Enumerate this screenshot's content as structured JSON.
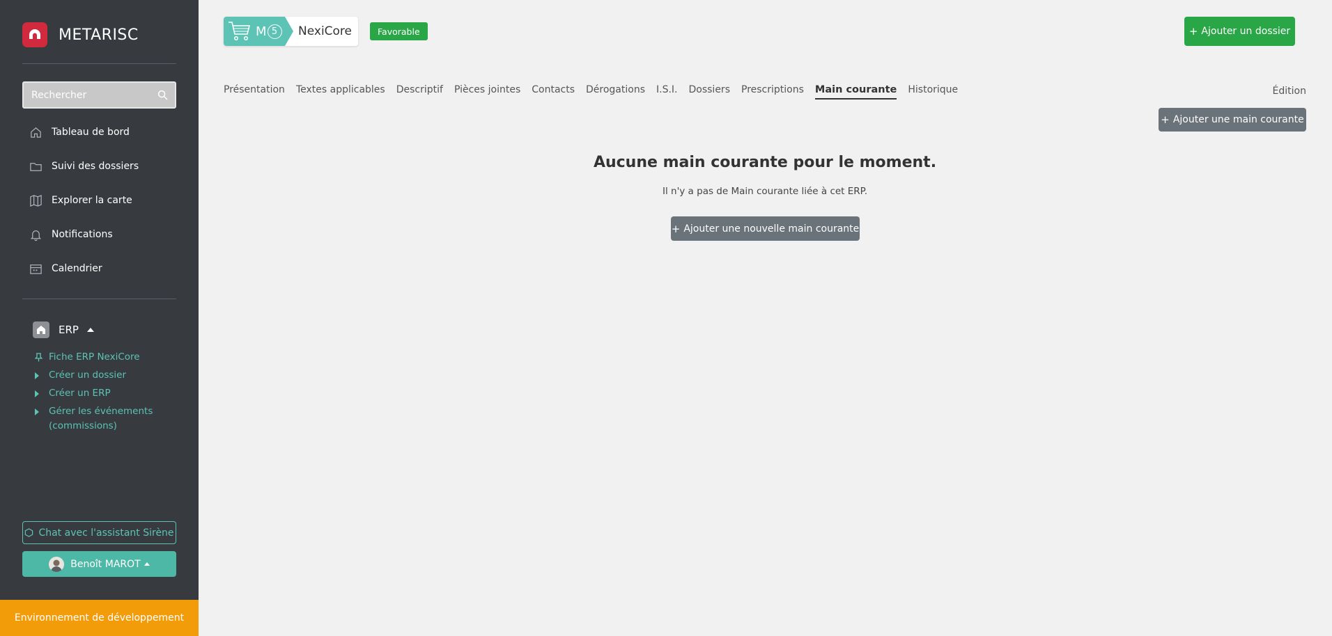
{
  "app": {
    "name": "METARISC",
    "brand_color": "#d1293d"
  },
  "sidebar": {
    "search_placeholder": "Rechercher",
    "nav": [
      {
        "label": "Tableau de bord",
        "icon": "home-icon"
      },
      {
        "label": "Suivi des dossiers",
        "icon": "folder-icon"
      },
      {
        "label": "Explorer la carte",
        "icon": "map-icon"
      },
      {
        "label": "Notifications",
        "icon": "bell-icon"
      },
      {
        "label": "Calendrier",
        "icon": "calendar-icon"
      }
    ],
    "erp_section": {
      "label": "ERP",
      "items": [
        {
          "label": "Fiche ERP NexiCore",
          "icon": "pin-icon"
        },
        {
          "label": "Créer un dossier",
          "icon": "caret-right-icon"
        },
        {
          "label": "Créer un ERP",
          "icon": "caret-right-icon"
        },
        {
          "label": "Gérer les événements (commissions)",
          "icon": "caret-right-icon"
        }
      ]
    },
    "chat_label": "Chat avec l'assistant Sirène",
    "user_name": "Benoît MAROT",
    "environment": "Environnement de développement"
  },
  "header": {
    "erp_type": "M",
    "erp_category": "5",
    "erp_name": "NexiCore",
    "avis": "Favorable",
    "add_dossier": "Ajouter un dossier"
  },
  "tabs": [
    {
      "label": "Présentation",
      "active": false
    },
    {
      "label": "Textes applicables",
      "active": false
    },
    {
      "label": "Descriptif",
      "active": false
    },
    {
      "label": "Pièces jointes",
      "active": false
    },
    {
      "label": "Contacts",
      "active": false
    },
    {
      "label": "Dérogations",
      "active": false
    },
    {
      "label": "I.S.I.",
      "active": false
    },
    {
      "label": "Dossiers",
      "active": false
    },
    {
      "label": "Prescriptions",
      "active": false
    },
    {
      "label": "Main courante",
      "active": true
    },
    {
      "label": "Historique",
      "active": false
    }
  ],
  "edition_label": "Édition",
  "main": {
    "add_main_courante": "Ajouter une main courante",
    "empty_title": "Aucune main courante pour le moment.",
    "empty_text": "Il n'y a pas de Main courante liée à cet ERP.",
    "add_new_main_courante": "Ajouter une nouvelle main courante"
  },
  "colors": {
    "sidebar_bg": "#373b40",
    "teal": "#5cc3b5",
    "green": "#29a645",
    "env_orange": "#f39c0a",
    "grey_button": "#6a727a"
  }
}
